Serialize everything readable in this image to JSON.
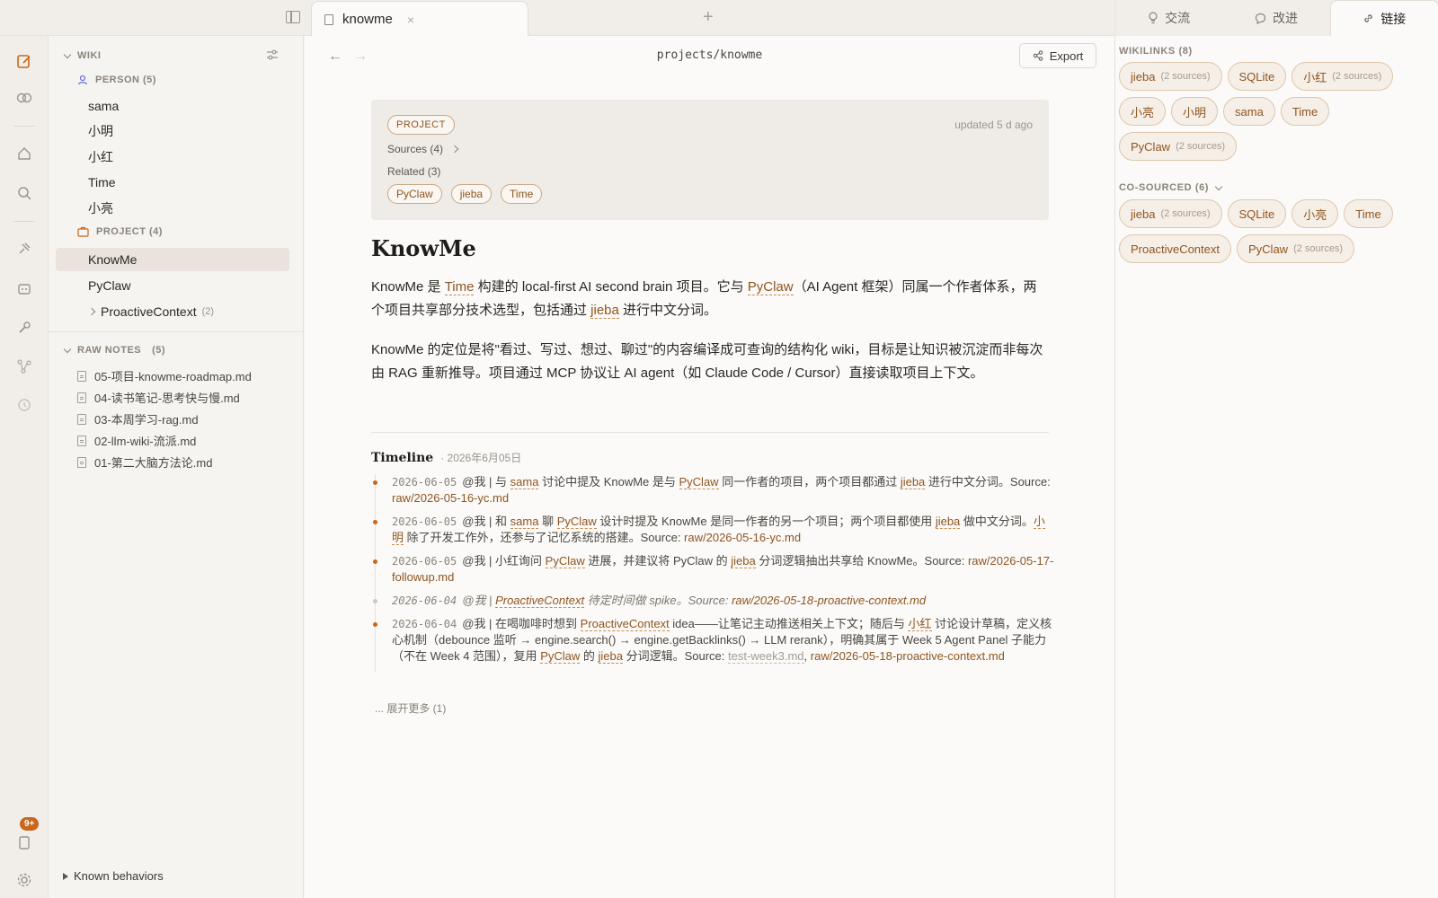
{
  "tab": {
    "label": "knowme",
    "close": "×",
    "new": "+"
  },
  "main": {
    "path": "projects/knowme",
    "export_label": "Export",
    "back": "←",
    "forward": "→",
    "meta": {
      "type": "PROJECT",
      "updated": "updated 5 d ago",
      "sources": "Sources (4)",
      "related_label": "Related (3)",
      "related": [
        "PyClaw",
        "jieba",
        "Time"
      ]
    },
    "title": "KnowMe",
    "p1": {
      "a": "KnowMe 是 ",
      "l1": "Time",
      "b": " 构建的 local-first AI second brain 项目。它与 ",
      "l2": "PyClaw",
      "c": "（AI Agent 框架）同属一个作者体系，两个项目共享部分技术选型，包括通过 ",
      "l3": "jieba",
      "d": " 进行中文分词。"
    },
    "p2": "KnowMe 的定位是将\"看过、写过、想过、聊过\"的内容编译成可查询的结构化 wiki，目标是让知识被沉淀而非每次由 RAG 重新推导。项目通过 MCP 协议让 AI agent（如 Claude Code / Cursor）直接读取项目上下文。",
    "timeline": {
      "title": "Timeline",
      "date": "· 2026年6月05日",
      "entries": [
        {
          "date": "2026-06-05",
          "t1": "@我 | 与 ",
          "l1": "sama",
          "t2": " 讨论中提及 KnowMe 是与 ",
          "l2": "PyClaw",
          "t3": " 同一作者的项目，两个项目都通过 ",
          "l3": "jieba",
          "t4": " 进行中文分词。Source: ",
          "src": "raw/2026-05-16-yc.md"
        },
        {
          "date": "2026-06-05",
          "t1": "@我 | 和 ",
          "l1": "sama",
          "t2": " 聊 ",
          "l2": "PyClaw",
          "t3": " 设计时提及 KnowMe 是同一作者的另一个项目；两个项目都使用 ",
          "l3": "jieba",
          "t4": " 做中文分词。",
          "l4": "小明",
          "t5": " 除了开发工作外，还参与了记忆系统的搭建。Source: ",
          "src": "raw/2026-05-16-yc.md"
        },
        {
          "date": "2026-06-05",
          "t1": "@我 | 小红询问 ",
          "l1": "PyClaw",
          "t2": " 进展，并建议将 PyClaw 的 ",
          "l2": "jieba",
          "t3": " 分词逻辑抽出共享给 KnowMe。Source: ",
          "src": "raw/2026-05-17-followup.md"
        },
        {
          "date": "2026-06-04",
          "t1": "@我 | ",
          "l1": "ProactiveContext",
          "t2": " 待定时间做 spike。Source: ",
          "src": "raw/2026-05-18-proactive-context.md"
        },
        {
          "date": "2026-06-04",
          "t1": "@我 | 在喝咖啡时想到 ",
          "l1": "ProactiveContext",
          "t2": " idea——让笔记主动推送相关上下文；随后与 ",
          "l2": "小红",
          "t3": " 讨论设计草稿，定义核心机制（debounce 监听 → engine.search() → engine.getBacklinks() → LLM rerank），明确其属于 Week 5 Agent Panel 子能力（不在 Week 4 范围），复用 ",
          "l3": "PyClaw",
          "t4": " 的 ",
          "l4": "jieba",
          "t5": " 分词逻辑。Source: ",
          "src_grey": "test-week3.md",
          "sep": ", ",
          "src": "raw/2026-05-18-proactive-context.md"
        }
      ],
      "expand": "... 展开更多 (1)"
    }
  },
  "sidebar": {
    "wiki_label": "WIKI",
    "person_label": "PERSON (5)",
    "persons": [
      "sama",
      "小明",
      "小红",
      "Time",
      "小亮"
    ],
    "project_label": "PROJECT (4)",
    "projects": [
      "KnowMe",
      "PyClaw"
    ],
    "proactive": {
      "label": "ProactiveContext",
      "count": "(2)"
    },
    "raw_label": "RAW NOTES",
    "raw_count": "(5)",
    "raw_notes": [
      "05-项目-knowme-roadmap.md",
      "04-读书笔记-思考快与慢.md",
      "03-本周学习-rag.md",
      "02-llm-wiki-流派.md",
      "01-第二大脑方法论.md"
    ],
    "known": "Known behaviors",
    "badge": "9+"
  },
  "rpanel": {
    "tabs": [
      "交流",
      "改进",
      "链接"
    ],
    "wikilinks_label": "WIKILINKS (8)",
    "wikilinks": [
      {
        "name": "jieba",
        "n": "(2 sources)"
      },
      {
        "name": "SQLite",
        "n": ""
      },
      {
        "name": "小红",
        "n": "(2 sources)"
      },
      {
        "name": "小亮",
        "n": ""
      },
      {
        "name": "小明",
        "n": ""
      },
      {
        "name": "sama",
        "n": ""
      },
      {
        "name": "Time",
        "n": ""
      },
      {
        "name": "PyClaw",
        "n": "(2 sources)"
      }
    ],
    "cosourced_label": "CO-SOURCED (6)",
    "cosourced": [
      {
        "name": "jieba",
        "n": "(2 sources)"
      },
      {
        "name": "SQLite",
        "n": ""
      },
      {
        "name": "小亮",
        "n": ""
      },
      {
        "name": "Time",
        "n": ""
      },
      {
        "name": "ProactiveContext",
        "n": ""
      },
      {
        "name": "PyClaw",
        "n": "(2 sources)"
      }
    ]
  },
  "colors": {
    "accent": "#c7681d",
    "link": "#8f5520"
  }
}
